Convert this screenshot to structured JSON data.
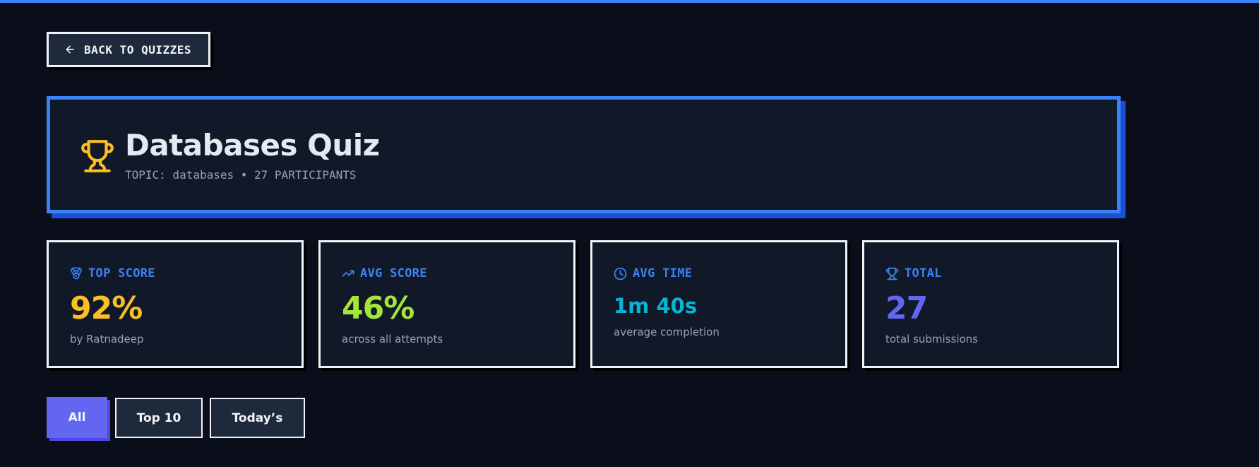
{
  "nav": {
    "back_label": "BACK TO QUIZZES"
  },
  "quiz": {
    "title": "Databases Quiz",
    "subtitle": "TOPIC: databases • 27 PARTICIPANTS"
  },
  "stats": [
    {
      "label": "TOP SCORE",
      "value": "92%",
      "desc": "by Ratnadeep",
      "icon": "medal-icon",
      "color": "#fbbf24"
    },
    {
      "label": "AVG SCORE",
      "value": "46%",
      "desc": "across all attempts",
      "icon": "trending-up-icon",
      "color": "#a3e635"
    },
    {
      "label": "AVG TIME",
      "value": "1m 40s",
      "desc": "average completion",
      "icon": "clock-icon",
      "color": "#06b6d4"
    },
    {
      "label": "TOTAL",
      "value": "27",
      "desc": "total submissions",
      "icon": "trophy-icon",
      "color": "#6366f1"
    }
  ],
  "filters": [
    {
      "label": "All",
      "active": true
    },
    {
      "label": "Top 10",
      "active": false
    },
    {
      "label": "Today’s",
      "active": false
    }
  ],
  "colors": {
    "accent": "#3b82f6",
    "background": "#0a0e1a",
    "card": "#111827",
    "active_filter": "#6366f1",
    "trophy": "#fbbf24"
  }
}
